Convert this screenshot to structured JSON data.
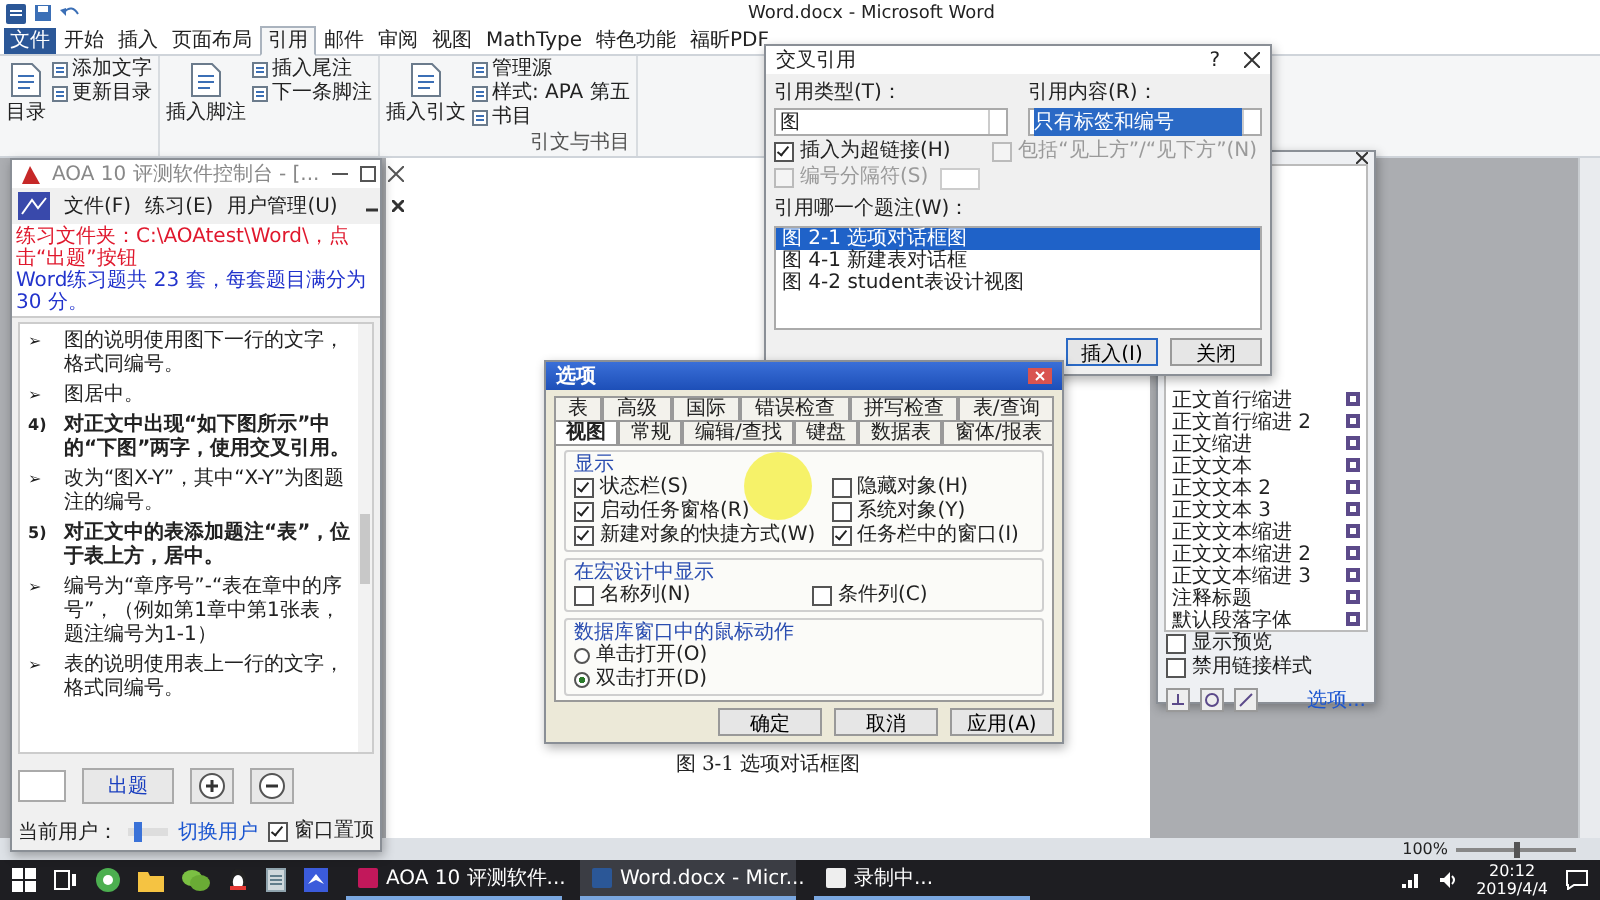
{
  "word": {
    "title": "Word.docx - Microsoft Word",
    "tabs": [
      {
        "label": "文件",
        "kind": "file",
        "selected": false
      },
      {
        "label": "开始",
        "kind": "tab",
        "selected": false
      },
      {
        "label": "插入",
        "kind": "tab",
        "selected": false
      },
      {
        "label": "页面布局",
        "kind": "tab",
        "selected": false
      },
      {
        "label": "引用",
        "kind": "tab",
        "selected": true
      },
      {
        "label": "邮件",
        "kind": "tab",
        "selected": false
      },
      {
        "label": "审阅",
        "kind": "tab",
        "selected": false
      },
      {
        "label": "视图",
        "kind": "tab",
        "selected": false
      },
      {
        "label": "MathType",
        "kind": "tab",
        "selected": false
      },
      {
        "label": "特色功能",
        "kind": "tab",
        "selected": false
      },
      {
        "label": "福昕PDF",
        "kind": "tab",
        "selected": false
      }
    ],
    "ribbon_groups": [
      {
        "buttons": [
          {
            "kind": "big",
            "label": "目录"
          },
          {
            "kind": "small",
            "label": "添加文字"
          },
          {
            "kind": "small",
            "label": "更新目录"
          }
        ]
      },
      {
        "buttons": [
          {
            "kind": "big",
            "label": "插入脚注"
          },
          {
            "kind": "small",
            "label": "插入尾注"
          },
          {
            "kind": "small",
            "label": "下一条脚注"
          }
        ]
      },
      {
        "label": "引文与书目",
        "buttons": [
          {
            "kind": "big",
            "label": "插入引文"
          },
          {
            "kind": "small",
            "label": "管理源"
          },
          {
            "kind": "small",
            "label": "样式: APA 第五"
          },
          {
            "kind": "small",
            "label": "书目"
          }
        ]
      }
    ],
    "caption": "图 3-1 选项对话框图",
    "zoom": "100%",
    "zoom_slider": {
      "level": 0.5
    }
  },
  "practice_window": {
    "title": "AOA 10 评测软件控制台 - [...",
    "menu": [
      "文件(F)",
      "练习(E)",
      "用户管理(U)"
    ],
    "notice": [
      {
        "kind": "warning",
        "text": "练习文件夹：C:\\AOAtest\\Word\\，点击“出题”按钮"
      },
      {
        "kind": "info",
        "text": "Word练习题共 23 套，每套题目满分为 30 分。"
      }
    ],
    "items": [
      {
        "kind": "bullet",
        "marker": "➢",
        "text": "图的说明使用图下一行的文字，格式同编号。"
      },
      {
        "kind": "bullet",
        "marker": "➢",
        "text": "图居中。"
      },
      {
        "kind": "step",
        "marker": "4)",
        "text": "对正文中出现“如下图所示”中的“下图”两字，使用交叉引用。"
      },
      {
        "kind": "bullet",
        "marker": "➢",
        "text": "改为“图X-Y”，其中“X-Y”为图题注的编号。"
      },
      {
        "kind": "step",
        "marker": "5)",
        "text": "对正文中的表添加题注“表”，位于表上方，居中。"
      },
      {
        "kind": "bullet",
        "marker": "➢",
        "text": "编号为“章序号”-“表在章中的序号”，（例如第1章中第1张表，题注编号为1-1）"
      },
      {
        "kind": "bullet",
        "marker": "➢",
        "text": "表的说明使用表上一行的文字，格式同编号。"
      }
    ],
    "buttons": [
      {
        "kind": "text",
        "label": "出题"
      },
      {
        "kind": "zoom_in"
      },
      {
        "kind": "zoom_out"
      }
    ],
    "user_label": "当前用户：",
    "user_slider": {
      "level": 0.15
    },
    "user_link": "切换用户",
    "topmost": {
      "label": "窗口置顶",
      "checked": true
    }
  },
  "cross_reference_dialog": {
    "title": "交叉引用",
    "help": "?",
    "type_label": "引用类型(T)：",
    "type_value": "图",
    "content_label": "引用内容(R)：",
    "content_value": "只有标签和编号",
    "checks": [
      {
        "label": "插入为超链接(H)",
        "checked": true,
        "disabled": false
      },
      {
        "label": "编号分隔符(S)",
        "checked": false,
        "disabled": true
      }
    ],
    "include_check": {
      "label": "包括“见上方”/“见下方”(N)",
      "checked": false,
      "disabled": true
    },
    "list_label": "引用哪一个题注(W)：",
    "captions": [
      {
        "label": "图 2-1 选项对话框图",
        "selected": true
      },
      {
        "label": "图 4-1 新建表对话框",
        "selected": false
      },
      {
        "label": "图 4-2 student表设计视图",
        "selected": false
      }
    ],
    "buttons": [
      {
        "label": "插入(I)",
        "kind": "default"
      },
      {
        "label": "关闭",
        "kind": "normal"
      }
    ]
  },
  "options_dialog": {
    "title": "选项",
    "tab_rows": [
      [
        {
          "label": "表",
          "selected": false
        },
        {
          "label": "高级",
          "selected": false
        },
        {
          "label": "国际",
          "selected": false
        },
        {
          "label": "错误检查",
          "selected": false
        },
        {
          "label": "拼写检查",
          "selected": false
        },
        {
          "label": "表/查询",
          "selected": false
        }
      ],
      [
        {
          "label": "视图",
          "selected": true
        },
        {
          "label": "常规",
          "selected": false
        },
        {
          "label": "编辑/查找",
          "selected": false
        },
        {
          "label": "键盘",
          "selected": false
        },
        {
          "label": "数据表",
          "selected": false
        },
        {
          "label": "窗体/报表",
          "selected": false
        }
      ]
    ],
    "groups": [
      {
        "title": "显示",
        "kind": "checks",
        "options": [
          {
            "label": "状态栏(S)",
            "checked": true
          },
          {
            "label": "隐藏对象(H)",
            "checked": false
          },
          {
            "label": "启动任务窗格(R)",
            "checked": true
          },
          {
            "label": "系统对象(Y)",
            "checked": false
          },
          {
            "label": "新建对象的快捷方式(W)",
            "checked": true
          },
          {
            "label": "任务栏中的窗口(I)",
            "checked": true
          }
        ]
      },
      {
        "title": "在宏设计中显示",
        "kind": "checks",
        "options": [
          {
            "label": "名称列(N)",
            "checked": false
          },
          {
            "label": "条件列(C)",
            "checked": false
          }
        ]
      },
      {
        "title": "数据库窗口中的鼠标动作",
        "kind": "radios",
        "options": [
          {
            "label": "单击打开(O)",
            "selected": false
          },
          {
            "label": "双击打开(D)",
            "selected": true
          }
        ]
      }
    ],
    "buttons": [
      "确定",
      "取消",
      "应用(A)"
    ]
  },
  "styles_pane": {
    "styles": [
      {
        "label": "正文首行缩进",
        "selected": false
      },
      {
        "label": "正文首行缩进 2",
        "selected": false
      },
      {
        "label": "正文缩进",
        "selected": false
      },
      {
        "label": "正文文本",
        "selected": false
      },
      {
        "label": "正文文本 2",
        "selected": false
      },
      {
        "label": "正文文本 3",
        "selected": false
      },
      {
        "label": "正文文本缩进",
        "selected": false
      },
      {
        "label": "正文文本缩进 2",
        "selected": false
      },
      {
        "label": "正文文本缩进 3",
        "selected": false
      },
      {
        "label": "注释标题",
        "selected": false
      },
      {
        "label": "默认段落字体",
        "selected": false
      }
    ],
    "checks": [
      {
        "label": "显示预览",
        "checked": false
      },
      {
        "label": "禁用链接样式",
        "checked": false
      }
    ],
    "options_link": "选项..."
  },
  "taskbar": {
    "tasks": [
      {
        "label": "AOA 10 评测软件...",
        "active": false
      },
      {
        "label": "Word.docx - Micr...",
        "active": true
      },
      {
        "label": "录制中...",
        "active": false
      }
    ],
    "time": "20:12",
    "date": "2019/4/4"
  }
}
